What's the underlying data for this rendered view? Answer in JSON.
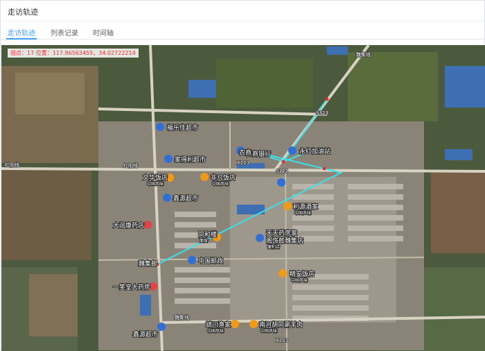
{
  "title": "走访轨迹",
  "tabs": [
    {
      "label": "走访轨迹",
      "active": true
    },
    {
      "label": "列表记录",
      "active": false
    },
    {
      "label": "时间轴",
      "active": false
    }
  ],
  "coord_text": "视点：17 位置：117.96563455，34.02722214",
  "accent_color": "#409eff",
  "track_color": "#3ee0e8",
  "map": {
    "pois": [
      {
        "name": "福乐佳超市",
        "icon": "shopping-pin-icon"
      },
      {
        "name": "家得利超市",
        "icon": "shopping-pin-icon"
      },
      {
        "name": "文华饭店",
        "sub": "中国风味",
        "icon": "food-pin-icon"
      },
      {
        "name": "非凡饭店",
        "sub": "中国风味",
        "icon": "food-pin-icon"
      },
      {
        "name": "鑫源超市",
        "icon": "shopping-pin-icon"
      },
      {
        "name": "利源酒家",
        "sub": "中国风味",
        "icon": "food-pin-icon"
      },
      {
        "name": "大润康药店",
        "icon": "pharmacy-pin-icon"
      },
      {
        "name": "同和楼",
        "sub": "面食",
        "icon": "food-pin-icon"
      },
      {
        "name": "天天药房家",
        "sub": "服装",
        "icon": "pharmacy-pin-icon"
      },
      {
        "name": "阁饰郎魏集店",
        "icon": ""
      },
      {
        "name": "便利店",
        "icon": ""
      },
      {
        "name": "中国邮政",
        "icon": "post-pin-icon"
      },
      {
        "name": "魏集邮",
        "icon": ""
      },
      {
        "name": "精安饭店",
        "sub": "中国风味",
        "icon": "food-pin-icon"
      },
      {
        "name": "一笑堂大药房",
        "icon": "pharmacy-pin-icon"
      },
      {
        "name": "靖川渔家",
        "sub": "中国风味",
        "icon": "food-pin-icon"
      },
      {
        "name": "南河胡同涮羊肉",
        "sub": "中国风味",
        "icon": "food-pin-icon"
      },
      {
        "name": "鑫源超市",
        "icon": "shopping-pin-icon"
      },
      {
        "name": "农商银行",
        "icon": "bank-pin-icon"
      },
      {
        "name": "永红加油站",
        "icon": "gas-pin-icon"
      },
      {
        "name": "农商",
        "icon": ""
      }
    ],
    "road_labels": [
      "红阳线",
      "红阳线",
      "魏集线",
      "魏集线",
      "S323",
      "S323",
      "X203",
      "X203"
    ]
  }
}
